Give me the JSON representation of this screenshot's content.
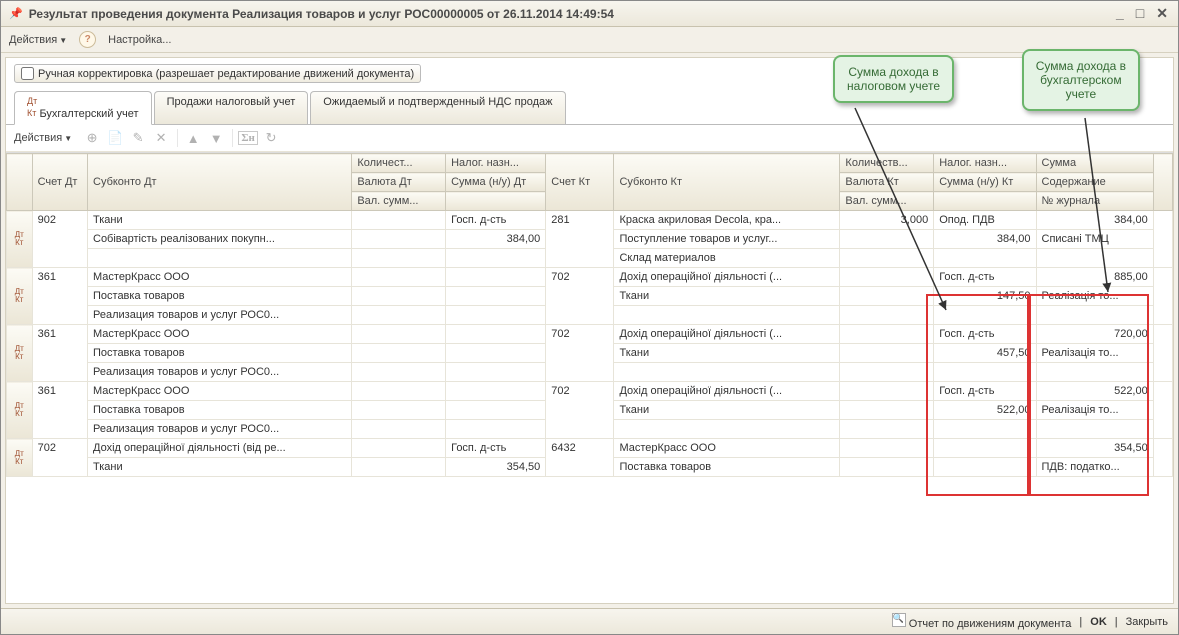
{
  "window": {
    "title": "Результат проведения документа Реализация товаров и услуг РОС00000005 от 26.11.2014 14:49:54"
  },
  "menubar": {
    "actions": "Действия",
    "settings": "Настройка..."
  },
  "manual_correction_label": "Ручная корректировка (разрешает редактирование движений документа)",
  "tabs": {
    "t1": "Бухгалтерский учет",
    "t2": "Продажи налоговый учет",
    "t3": "Ожидаемый и подтвержденный НДС продаж"
  },
  "toolbar": {
    "actions": "Действия"
  },
  "callouts": {
    "c1_l1": "Сумма дохода в",
    "c1_l2": "налоговом учете",
    "c2_l1": "Сумма дохода в",
    "c2_l2": "бухгалтерском",
    "c2_l3": "учете"
  },
  "headers": {
    "acct_dt": "Счет Дт",
    "sub_dt": "Субконто Дт",
    "qty": "Количест...",
    "tax": "Налог. назн...",
    "acct_kt": "Счет Кт",
    "sub_kt": "Субконто Кт",
    "qty2": "Количеств...",
    "tax2": "Налог. назн...",
    "sum": "Сумма",
    "currency_dt": "Валюта Дт",
    "sum_nu_dt": "Сумма (н/у) Дт",
    "currency_kt": "Валюта Кт",
    "sum_nu_kt": "Сумма (н/у) Кт",
    "content": "Содержание",
    "val_sum": "Вал. сумм...",
    "val_sum2": "Вал. сумм...",
    "journal": "№ журнала"
  },
  "rows": [
    {
      "acct_dt": "902",
      "sub_dt": [
        "Ткани",
        "Собівартість реалізованих покупн..."
      ],
      "tax": [
        "Госп. д-сть",
        "384,00"
      ],
      "acct_kt": "281",
      "sub_kt": [
        "Краска акриловая Decola, кра...",
        "Поступление товаров и услуг...",
        "Склад материалов"
      ],
      "qty2": "3,000",
      "tax2": [
        "Опод. ПДВ",
        "384,00"
      ],
      "sum": [
        "384,00",
        "Списані ТМЦ"
      ]
    },
    {
      "acct_dt": "361",
      "sub_dt": [
        " МастерКрасс ООО",
        "Поставка товаров",
        "Реализация товаров и услуг РОС0..."
      ],
      "tax": [
        "",
        ""
      ],
      "acct_kt": "702",
      "sub_kt": [
        "Дохід операційної діяльності (...",
        "Ткани",
        ""
      ],
      "qty2": "",
      "tax2": [
        "Госп. д-сть",
        "147,50"
      ],
      "sum": [
        "885,00",
        "Реалізація то..."
      ]
    },
    {
      "acct_dt": "361",
      "sub_dt": [
        " МастерКрасс ООО",
        "Поставка товаров",
        "Реализация товаров и услуг РОС0..."
      ],
      "tax": [
        "",
        ""
      ],
      "acct_kt": "702",
      "sub_kt": [
        "Дохід операційної діяльності (...",
        "Ткани",
        ""
      ],
      "qty2": "",
      "tax2": [
        "Госп. д-сть",
        "457,50"
      ],
      "sum": [
        "720,00",
        "Реалізація то..."
      ]
    },
    {
      "acct_dt": "361",
      "sub_dt": [
        " МастерКрасс ООО",
        "Поставка товаров",
        "Реализация товаров и услуг РОС0..."
      ],
      "tax": [
        "",
        ""
      ],
      "acct_kt": "702",
      "sub_kt": [
        "Дохід операційної діяльності (...",
        "Ткани",
        ""
      ],
      "qty2": "",
      "tax2": [
        "Госп. д-сть",
        "522,00"
      ],
      "sum": [
        "522,00",
        "Реалізація то..."
      ]
    },
    {
      "acct_dt": "702",
      "sub_dt": [
        "Дохід операційної діяльності (від ре...",
        "Ткани"
      ],
      "tax": [
        "Госп. д-сть",
        "354,50"
      ],
      "acct_kt": "6432",
      "sub_kt": [
        " МастерКрасс ООО",
        "Поставка товаров"
      ],
      "qty2": "",
      "tax2": [
        "",
        ""
      ],
      "sum": [
        "354,50",
        "ПДВ: податко..."
      ]
    }
  ],
  "footer": {
    "report": "Отчет по движениям документа",
    "ok": "OK",
    "close": "Закрыть"
  }
}
